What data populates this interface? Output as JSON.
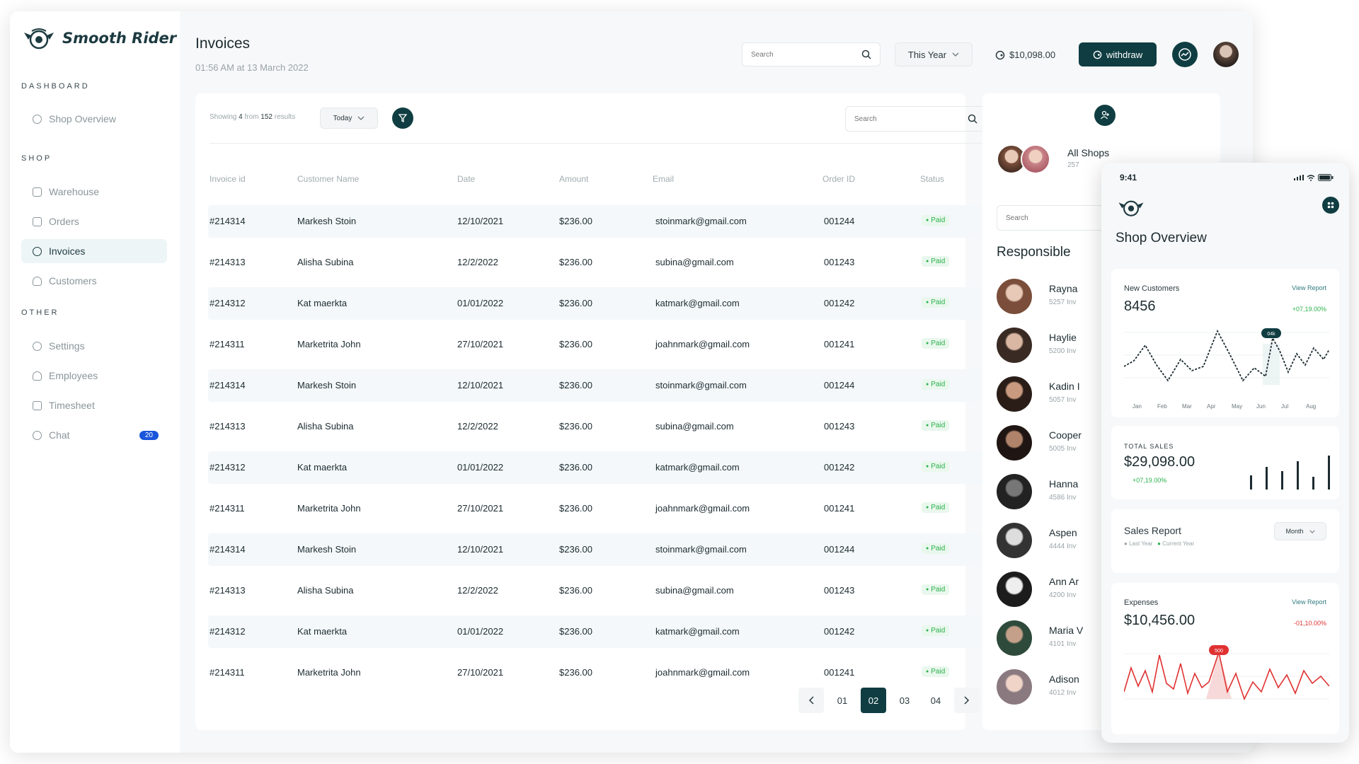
{
  "app": {
    "name": "Smooth Rider"
  },
  "sidebar": {
    "sections": [
      {
        "title": "DASHBOARD"
      },
      {
        "title": "SHOP"
      },
      {
        "title": "OTHER"
      }
    ],
    "items": [
      {
        "label": "Shop Overview",
        "icon": "gauge-icon"
      },
      {
        "label": "Warehouse",
        "icon": "grid-icon"
      },
      {
        "label": "Orders",
        "icon": "box-icon"
      },
      {
        "label": "Invoices",
        "icon": "invoice-icon",
        "active": true
      },
      {
        "label": "Customers",
        "icon": "user-icon"
      },
      {
        "label": "Settings",
        "icon": "gear-icon"
      },
      {
        "label": "Employees",
        "icon": "users-icon"
      },
      {
        "label": "Timesheet",
        "icon": "calendar-icon"
      },
      {
        "label": "Chat",
        "icon": "chat-icon",
        "badge": "20"
      }
    ]
  },
  "header": {
    "title": "Invoices",
    "subtitle": "01:56 AM at 13 March 2022",
    "search_placeholder": "Search",
    "period": "This Year",
    "balance": "$10,098.00",
    "withdraw_label": "withdraw"
  },
  "invoices": {
    "showing_prefix": "Showing",
    "showing_count": "4",
    "showing_from": "from",
    "showing_total": "152",
    "showing_suffix": "results",
    "period": "Today",
    "search_placeholder": "Search",
    "columns": [
      "Invoice id",
      "Customer Name",
      "Date",
      "Amount",
      "Email",
      "Order ID",
      "Status"
    ],
    "rows": [
      [
        "#214314",
        "Markesh Stoin",
        "12/10/2021",
        "$236.00",
        "stoinmark@gmail.com",
        "001244",
        "Paid"
      ],
      [
        "#214313",
        "Alisha Subina",
        "12/2/2022",
        "$236.00",
        "subina@gmail.com",
        "001243",
        "Paid"
      ],
      [
        "#214312",
        "Kat maerkta",
        "01/01/2022",
        "$236.00",
        "katmark@gmail.com",
        "001242",
        "Paid"
      ],
      [
        "#214311",
        "Marketrita John",
        "27/10/2021",
        "$236.00",
        "joahnmark@gmail.com",
        "001241",
        "Paid"
      ],
      [
        "#214314",
        "Markesh Stoin",
        "12/10/2021",
        "$236.00",
        "stoinmark@gmail.com",
        "001244",
        "Paid"
      ],
      [
        "#214313",
        "Alisha Subina",
        "12/2/2022",
        "$236.00",
        "subina@gmail.com",
        "001243",
        "Paid"
      ],
      [
        "#214312",
        "Kat maerkta",
        "01/01/2022",
        "$236.00",
        "katmark@gmail.com",
        "001242",
        "Paid"
      ],
      [
        "#214311",
        "Marketrita John",
        "27/10/2021",
        "$236.00",
        "joahnmark@gmail.com",
        "001241",
        "Paid"
      ],
      [
        "#214314",
        "Markesh Stoin",
        "12/10/2021",
        "$236.00",
        "stoinmark@gmail.com",
        "001244",
        "Paid"
      ],
      [
        "#214313",
        "Alisha Subina",
        "12/2/2022",
        "$236.00",
        "subina@gmail.com",
        "001243",
        "Paid"
      ],
      [
        "#214312",
        "Kat maerkta",
        "01/01/2022",
        "$236.00",
        "katmark@gmail.com",
        "001242",
        "Paid"
      ],
      [
        "#214311",
        "Marketrita John",
        "27/10/2021",
        "$236.00",
        "joahnmark@gmail.com",
        "001241",
        "Paid"
      ]
    ],
    "pages": [
      "01",
      "02",
      "03",
      "04"
    ],
    "current_page": "02"
  },
  "right_panel": {
    "all_shops_label": "All Shops",
    "all_shops_count": "257",
    "search_placeholder": "Search",
    "responsible_title": "Responsible",
    "people": [
      {
        "name": "Rayna",
        "count": "5257 Inv"
      },
      {
        "name": "Haylie",
        "count": "5200 Inv"
      },
      {
        "name": "Kadin I",
        "count": "5057 Inv"
      },
      {
        "name": "Cooper",
        "count": "5005 Inv"
      },
      {
        "name": "Hanna",
        "count": "4586 Inv"
      },
      {
        "name": "Aspen",
        "count": "4444 Inv"
      },
      {
        "name": "Ann Ar",
        "count": "4200 Inv"
      },
      {
        "name": "Maria V",
        "count": "4101 Inv"
      },
      {
        "name": "Adison",
        "count": "4012 Inv"
      }
    ]
  },
  "mobile": {
    "time": "9:41",
    "title": "Shop Overview",
    "new_customers": {
      "label": "New Customers",
      "value": "8456",
      "link": "View Report",
      "change": "+07,19.00%",
      "marker": "04k",
      "months": [
        "Jan",
        "Feb",
        "Mar",
        "Apr",
        "May",
        "Jun",
        "Jul",
        "Aug"
      ]
    },
    "total_sales": {
      "label": "TOTAL SALES",
      "value": "$29,098.00",
      "change": "+07,19.00%"
    },
    "sales_report": {
      "label": "Sales Report",
      "period": "Month",
      "legend_last": "Last Year",
      "legend_current": "Current Year"
    },
    "expenses": {
      "label": "Expenses",
      "value": "$10,456.00",
      "link": "View Report",
      "change": "-01,10.00%",
      "marker": "500"
    }
  },
  "colors": {
    "primary": "#0f3d42",
    "paid": "#2bb24c",
    "negative": "#e03131",
    "badge": "#1a56db"
  }
}
